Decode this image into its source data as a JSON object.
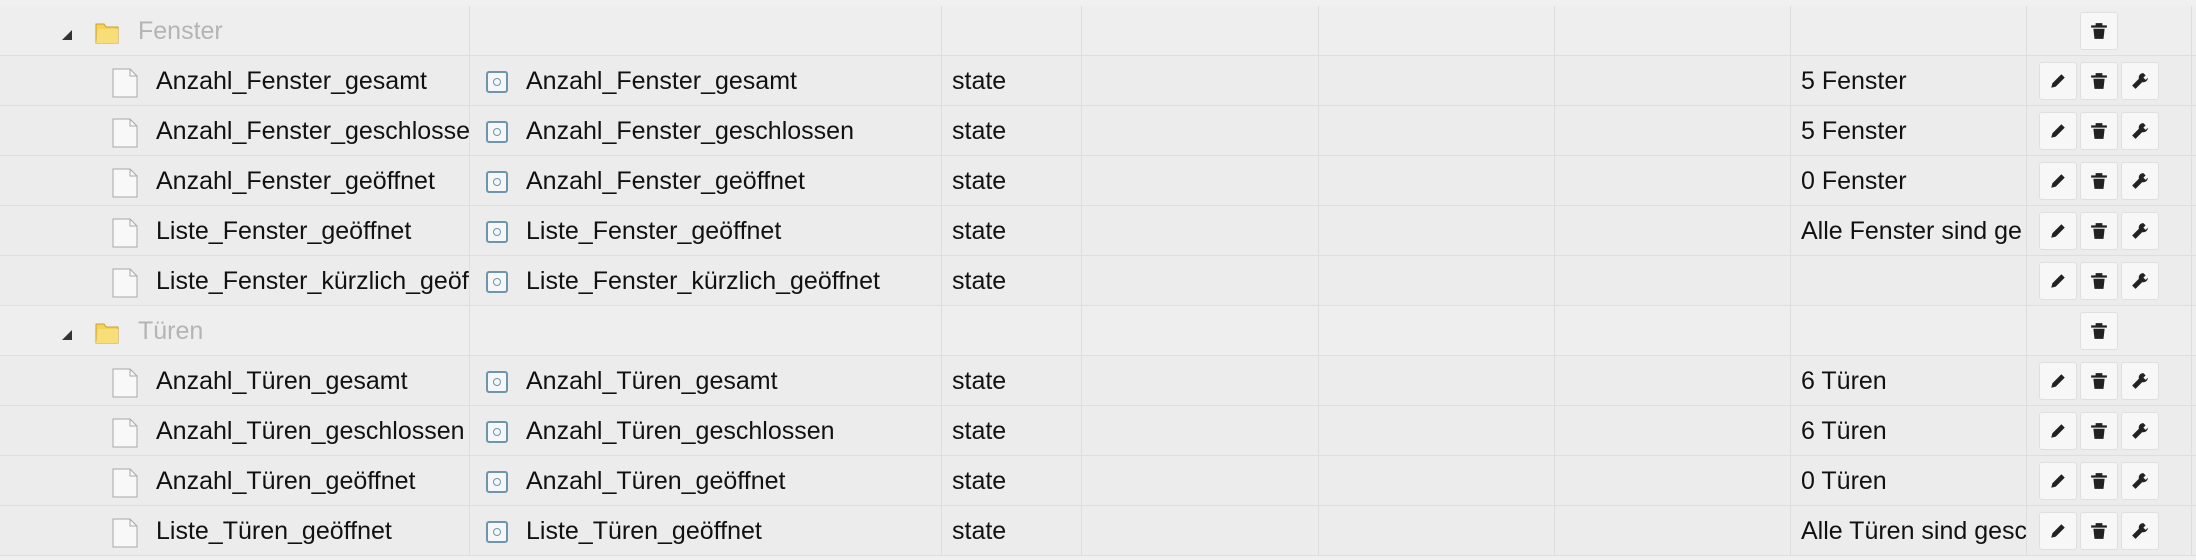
{
  "folders": [
    {
      "name": "Fenster",
      "items": [
        {
          "name": "Anzahl_Fenster_gesamt",
          "title": "Anzahl_Fenster_gesamt",
          "type": "state",
          "value": "5 Fenster"
        },
        {
          "name": "Anzahl_Fenster_geschlossen",
          "title": "Anzahl_Fenster_geschlossen",
          "type": "state",
          "value": "5 Fenster"
        },
        {
          "name": "Anzahl_Fenster_geöffnet",
          "title": "Anzahl_Fenster_geöffnet",
          "type": "state",
          "value": "0 Fenster"
        },
        {
          "name": "Liste_Fenster_geöffnet",
          "title": "Liste_Fenster_geöffnet",
          "type": "state",
          "value": "Alle Fenster sind ge"
        },
        {
          "name": "Liste_Fenster_kürzlich_geöffnet",
          "title": "Liste_Fenster_kürzlich_geöffnet",
          "type": "state",
          "value": ""
        }
      ]
    },
    {
      "name": "Türen",
      "items": [
        {
          "name": "Anzahl_Türen_gesamt",
          "title": "Anzahl_Türen_gesamt",
          "type": "state",
          "value": "6 Türen"
        },
        {
          "name": "Anzahl_Türen_geschlossen",
          "title": "Anzahl_Türen_geschlossen",
          "type": "state",
          "value": "6 Türen"
        },
        {
          "name": "Anzahl_Türen_geöffnet",
          "title": "Anzahl_Türen_geöffnet",
          "type": "state",
          "value": "0 Türen"
        },
        {
          "name": "Liste_Türen_geöffnet",
          "title": "Liste_Türen_geöffnet",
          "type": "state",
          "value": "Alle Türen sind gesc"
        }
      ]
    }
  ],
  "icons": {
    "folder": "folder-icon",
    "file": "file-icon",
    "state": "state-icon",
    "toggle": "collapse-triangle-icon",
    "edit": "pencil-icon",
    "delete": "trash-icon",
    "settings": "wrench-icon"
  },
  "colors": {
    "background": "#ececec",
    "folder_label": "#b4b4b4",
    "state_icon": "#6f95aa"
  }
}
